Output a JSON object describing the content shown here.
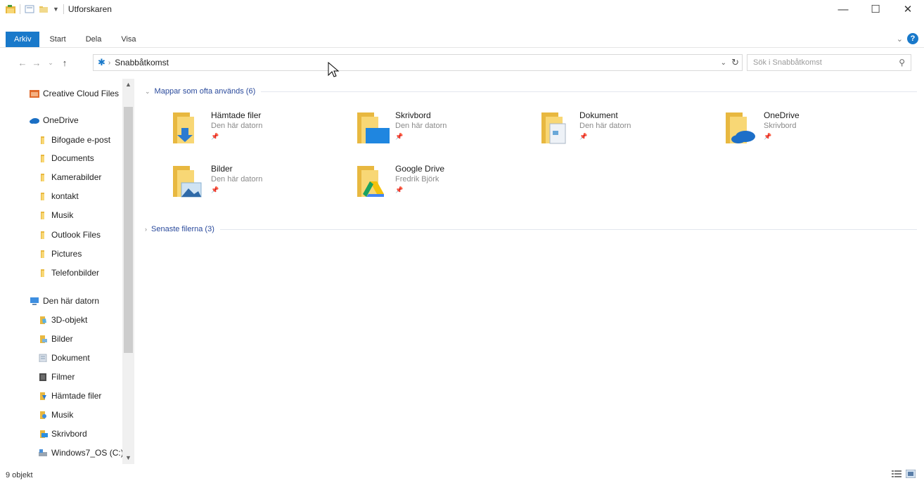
{
  "window": {
    "title": "Utforskaren",
    "controls": {
      "minimize": "—",
      "maximize": "☐",
      "close": "✕"
    }
  },
  "ribbon": {
    "tabs": [
      {
        "label": "Arkiv",
        "active": true
      },
      {
        "label": "Start",
        "active": false
      },
      {
        "label": "Dela",
        "active": false
      },
      {
        "label": "Visa",
        "active": false
      }
    ],
    "help": "?"
  },
  "address": {
    "crumb": "Snabbåtkomst",
    "search_placeholder": "Sök i Snabbåtkomst"
  },
  "nav": {
    "items": [
      {
        "label": "Creative Cloud Files",
        "icon": "creative-cloud-icon",
        "indent": 0
      },
      {
        "label": "OneDrive",
        "icon": "cloud-icon",
        "indent": 0
      },
      {
        "label": "Bifogade e-post",
        "icon": "folder-icon",
        "indent": 1
      },
      {
        "label": "Documents",
        "icon": "folder-icon",
        "indent": 1
      },
      {
        "label": "Kamerabilder",
        "icon": "folder-icon",
        "indent": 1
      },
      {
        "label": "kontakt",
        "icon": "folder-icon",
        "indent": 1
      },
      {
        "label": "Musik",
        "icon": "folder-icon",
        "indent": 1
      },
      {
        "label": "Outlook Files",
        "icon": "folder-icon",
        "indent": 1
      },
      {
        "label": "Pictures",
        "icon": "folder-icon",
        "indent": 1
      },
      {
        "label": "Telefonbilder",
        "icon": "folder-icon",
        "indent": 1
      },
      {
        "label": "Den här datorn",
        "icon": "computer-icon",
        "indent": 0
      },
      {
        "label": "3D-objekt",
        "icon": "3d-objects-icon",
        "indent": 1
      },
      {
        "label": "Bilder",
        "icon": "pictures-icon",
        "indent": 1
      },
      {
        "label": "Dokument",
        "icon": "documents-icon",
        "indent": 1
      },
      {
        "label": "Filmer",
        "icon": "videos-icon",
        "indent": 1
      },
      {
        "label": "Hämtade filer",
        "icon": "downloads-icon",
        "indent": 1
      },
      {
        "label": "Musik",
        "icon": "music-icon",
        "indent": 1
      },
      {
        "label": "Skrivbord",
        "icon": "desktop-icon",
        "indent": 1
      },
      {
        "label": "Windows7_OS (C:)",
        "icon": "drive-icon",
        "indent": 1
      }
    ]
  },
  "groups": {
    "frequent": {
      "title": "Mappar som ofta används (6)",
      "folders": [
        {
          "name": "Hämtade filer",
          "location": "Den här datorn",
          "icon": "downloads-folder-icon"
        },
        {
          "name": "Skrivbord",
          "location": "Den här datorn",
          "icon": "desktop-folder-icon"
        },
        {
          "name": "Dokument",
          "location": "Den här datorn",
          "icon": "documents-folder-icon"
        },
        {
          "name": "OneDrive",
          "location": "Skrivbord",
          "icon": "onedrive-folder-icon"
        },
        {
          "name": "Bilder",
          "location": "Den här datorn",
          "icon": "pictures-folder-icon"
        },
        {
          "name": "Google Drive",
          "location": "Fredrik Björk",
          "icon": "google-drive-folder-icon"
        }
      ]
    },
    "recent": {
      "title": "Senaste filerna (3)"
    }
  },
  "status": {
    "count": "9 objekt"
  },
  "colors": {
    "accent": "#1979ca",
    "folder": "#f8d775",
    "folder_dark": "#e8b840",
    "link": "#2a4a9c"
  }
}
